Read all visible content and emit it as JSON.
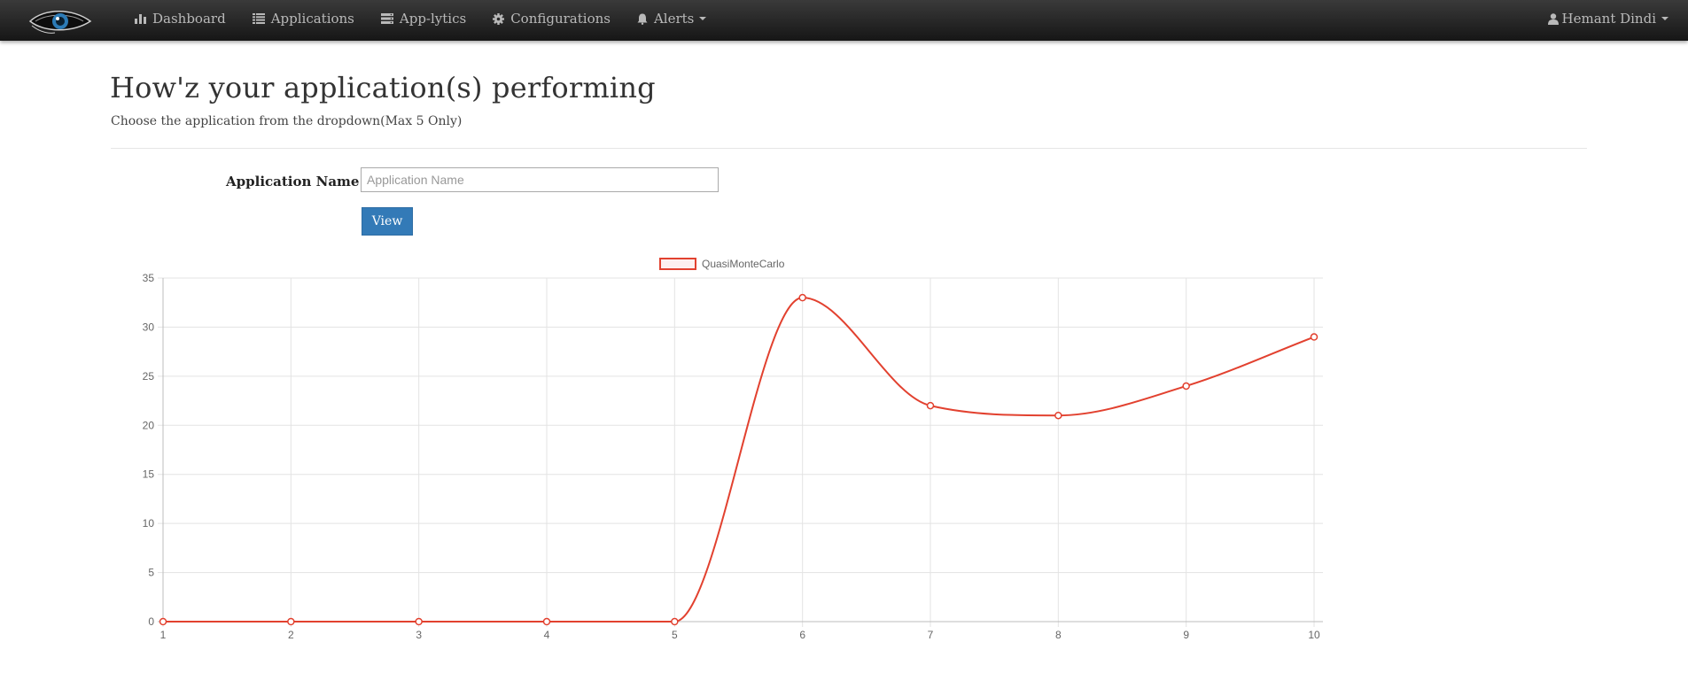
{
  "navbar": {
    "brand_name": "eye-logo",
    "items": [
      {
        "label": "Dashboard",
        "icon": "bar-chart-icon"
      },
      {
        "label": "Applications",
        "icon": "list-icon"
      },
      {
        "label": "App-lytics",
        "icon": "server-icon"
      },
      {
        "label": "Configurations",
        "icon": "gear-icon"
      },
      {
        "label": "Alerts",
        "icon": "bell-icon"
      }
    ],
    "user": {
      "label": "Hemant Dindi",
      "icon": "user-icon"
    }
  },
  "main": {
    "title": "How'z your application(s) performing",
    "subtitle": "Choose the application from the dropdown(Max 5 Only)",
    "form": {
      "label": "Application Name",
      "input_value": "",
      "input_placeholder": "Application Name",
      "view_label": "View"
    }
  },
  "colors": {
    "series": "#e2412f",
    "primary_button": "#337ab7",
    "navbar": "#222222"
  },
  "chart_data": {
    "type": "line",
    "x": [
      1,
      2,
      3,
      4,
      5,
      6,
      7,
      8,
      9,
      10
    ],
    "series": [
      {
        "name": "QuasiMonteCarlo",
        "values": [
          0,
          0,
          0,
          0,
          0,
          33,
          22,
          21,
          24,
          29
        ]
      }
    ],
    "ylim": [
      0,
      35
    ],
    "yticks": [
      0,
      5,
      10,
      15,
      20,
      25,
      30,
      35
    ],
    "grid": true,
    "legend": "top-center",
    "smooth": true
  }
}
